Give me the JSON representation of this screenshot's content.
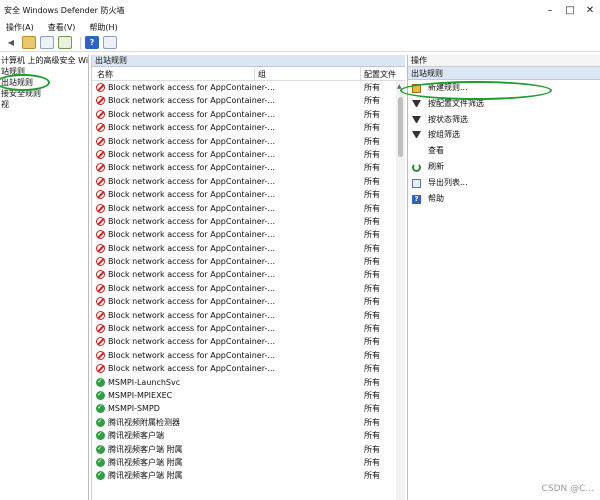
{
  "window": {
    "title": "安全 Windows Defender 防火墙"
  },
  "menu": [
    "操作(A)",
    "查看(V)",
    "帮助(H)"
  ],
  "tree": [
    "计算机 上的高级安全 Windo",
    "站规则",
    "出站规则",
    "接安全规则",
    "视"
  ],
  "panel": {
    "title": "出站规则"
  },
  "columns": {
    "name": "名称",
    "group": "组",
    "profile": "配置文件"
  },
  "rules": [
    {
      "name": "Block network access for AppContainer-...",
      "profile": "所有",
      "type": "block"
    },
    {
      "name": "Block network access for AppContainer-...",
      "profile": "所有",
      "type": "block"
    },
    {
      "name": "Block network access for AppContainer-...",
      "profile": "所有",
      "type": "block"
    },
    {
      "name": "Block network access for AppContainer-...",
      "profile": "所有",
      "type": "block"
    },
    {
      "name": "Block network access for AppContainer-...",
      "profile": "所有",
      "type": "block"
    },
    {
      "name": "Block network access for AppContainer-...",
      "profile": "所有",
      "type": "block"
    },
    {
      "name": "Block network access for AppContainer-...",
      "profile": "所有",
      "type": "block"
    },
    {
      "name": "Block network access for AppContainer-...",
      "profile": "所有",
      "type": "block"
    },
    {
      "name": "Block network access for AppContainer-...",
      "profile": "所有",
      "type": "block"
    },
    {
      "name": "Block network access for AppContainer-...",
      "profile": "所有",
      "type": "block"
    },
    {
      "name": "Block network access for AppContainer-...",
      "profile": "所有",
      "type": "block"
    },
    {
      "name": "Block network access for AppContainer-...",
      "profile": "所有",
      "type": "block"
    },
    {
      "name": "Block network access for AppContainer-...",
      "profile": "所有",
      "type": "block"
    },
    {
      "name": "Block network access for AppContainer-...",
      "profile": "所有",
      "type": "block"
    },
    {
      "name": "Block network access for AppContainer-...",
      "profile": "所有",
      "type": "block"
    },
    {
      "name": "Block network access for AppContainer-...",
      "profile": "所有",
      "type": "block"
    },
    {
      "name": "Block network access for AppContainer-...",
      "profile": "所有",
      "type": "block"
    },
    {
      "name": "Block network access for AppContainer-...",
      "profile": "所有",
      "type": "block"
    },
    {
      "name": "Block network access for AppContainer-...",
      "profile": "所有",
      "type": "block"
    },
    {
      "name": "Block network access for AppContainer-...",
      "profile": "所有",
      "type": "block"
    },
    {
      "name": "Block network access for AppContainer-...",
      "profile": "所有",
      "type": "block"
    },
    {
      "name": "Block network access for AppContainer-...",
      "profile": "所有",
      "type": "block"
    },
    {
      "name": "MSMPI-LaunchSvc",
      "profile": "所有",
      "type": "allow"
    },
    {
      "name": "MSMPI-MPIEXEC",
      "profile": "所有",
      "type": "allow"
    },
    {
      "name": "MSMPI-SMPD",
      "profile": "所有",
      "type": "allow"
    },
    {
      "name": "腾讯视频附属检测器",
      "profile": "所有",
      "type": "allow"
    },
    {
      "name": "腾讯视频客户端",
      "profile": "所有",
      "type": "allow"
    },
    {
      "name": "腾讯视频客户端 附属",
      "profile": "所有",
      "type": "allow"
    },
    {
      "name": "腾讯视频客户端 附属",
      "profile": "所有",
      "type": "allow"
    },
    {
      "name": "腾讯视频客户端 附属",
      "profile": "所有",
      "type": "allow"
    }
  ],
  "actions": {
    "header": "操作",
    "section": "出站规则",
    "items": [
      "新建规则...",
      "按配置文件筛选",
      "按状态筛选",
      "按组筛选",
      "查看",
      "刷新",
      "导出列表...",
      "帮助"
    ]
  },
  "watermark": "CSDN @C..."
}
